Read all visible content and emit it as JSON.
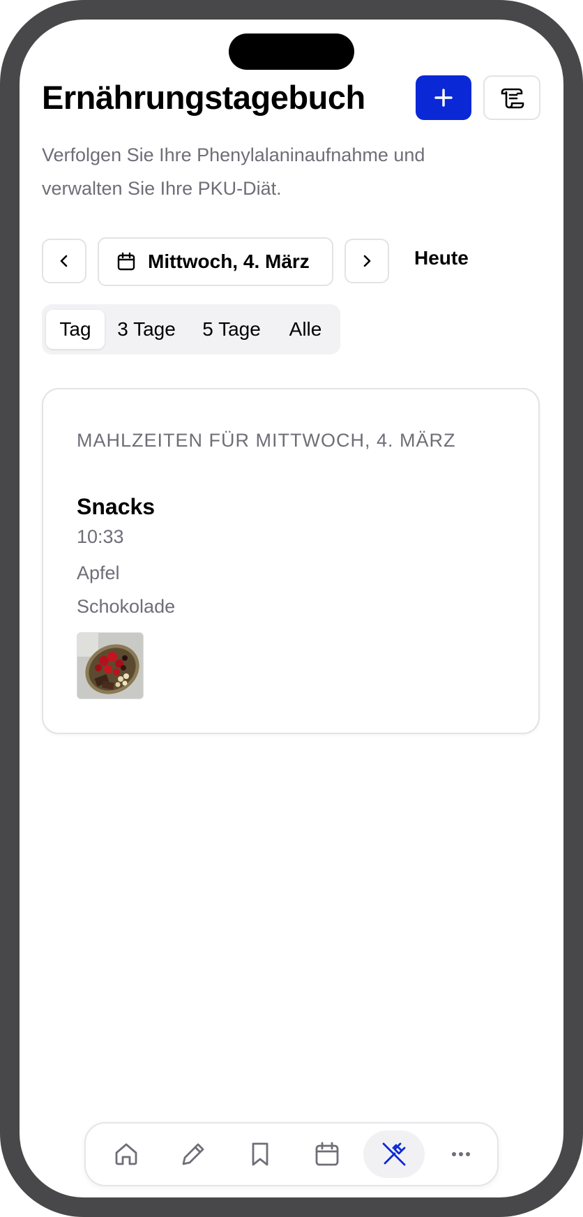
{
  "header": {
    "title": "Ernährungstagebuch",
    "subtitle": "Verfolgen Sie Ihre Phenylalaninaufnahme und verwalten Sie Ihre PKU-Diät.",
    "add_icon": "plus-icon",
    "log_icon": "scroll-icon",
    "accent_color": "#0b28d6"
  },
  "date_nav": {
    "prev_icon": "chevron-left-icon",
    "next_icon": "chevron-right-icon",
    "calendar_icon": "calendar-icon",
    "date_label": "Mittwoch, 4. März",
    "today_label": "Heute"
  },
  "range_tabs": [
    {
      "label": "Tag",
      "active": true
    },
    {
      "label": "3 Tage",
      "active": false
    },
    {
      "label": "5 Tage",
      "active": false
    },
    {
      "label": "Alle",
      "active": false
    }
  ],
  "meals_card": {
    "heading": "Mahlzeiten für Mittwoch, 4. März",
    "meal": {
      "title": "Snacks",
      "time": "10:33",
      "items": [
        "Apfel",
        "Schokolade"
      ],
      "photo": "food-photo"
    }
  },
  "tabbar": {
    "items": [
      {
        "icon": "home-icon",
        "active": false
      },
      {
        "icon": "pencil-icon",
        "active": false
      },
      {
        "icon": "bookmark-icon",
        "active": false
      },
      {
        "icon": "calendar-icon",
        "active": false
      },
      {
        "icon": "utensils-icon",
        "active": true
      },
      {
        "icon": "more-icon",
        "active": false
      }
    ]
  }
}
